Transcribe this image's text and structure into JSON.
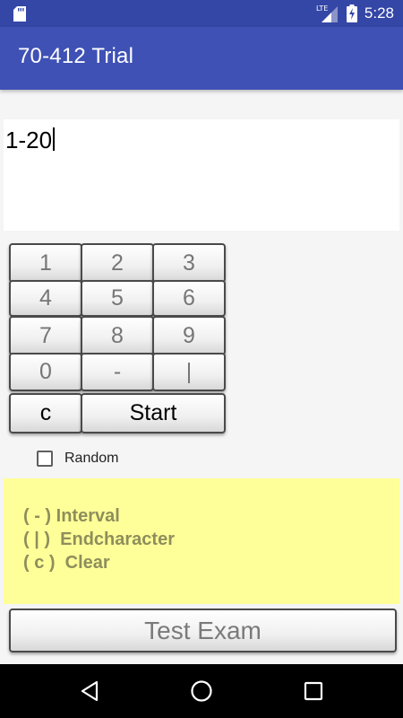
{
  "status_bar": {
    "time": "5:28",
    "network": "LTE",
    "icons": [
      "sd-card-icon",
      "lte-signal-icon",
      "battery-charging-icon"
    ]
  },
  "app": {
    "title": "70-412 Trial"
  },
  "input": {
    "value": "1-20"
  },
  "keypad": {
    "rows": [
      [
        "1",
        "2",
        "3"
      ],
      [
        "4",
        "5",
        "6"
      ],
      [
        "7",
        "8",
        "9"
      ],
      [
        "0",
        "-",
        "|"
      ]
    ],
    "clear_label": "c",
    "start_label": "Start"
  },
  "random_checkbox": {
    "label": "Random",
    "checked": false
  },
  "info": {
    "lines": [
      "( - ) Interval",
      "( | )  Endcharacter",
      "( c )  Clear"
    ],
    "background": "#ffff99"
  },
  "test_exam_button": {
    "label": "Test Exam"
  },
  "navigation": {
    "icons": [
      "back-icon",
      "home-icon",
      "recents-icon"
    ]
  },
  "colors": {
    "status_bar": "#3446a6",
    "app_bar": "#3f51b5"
  }
}
